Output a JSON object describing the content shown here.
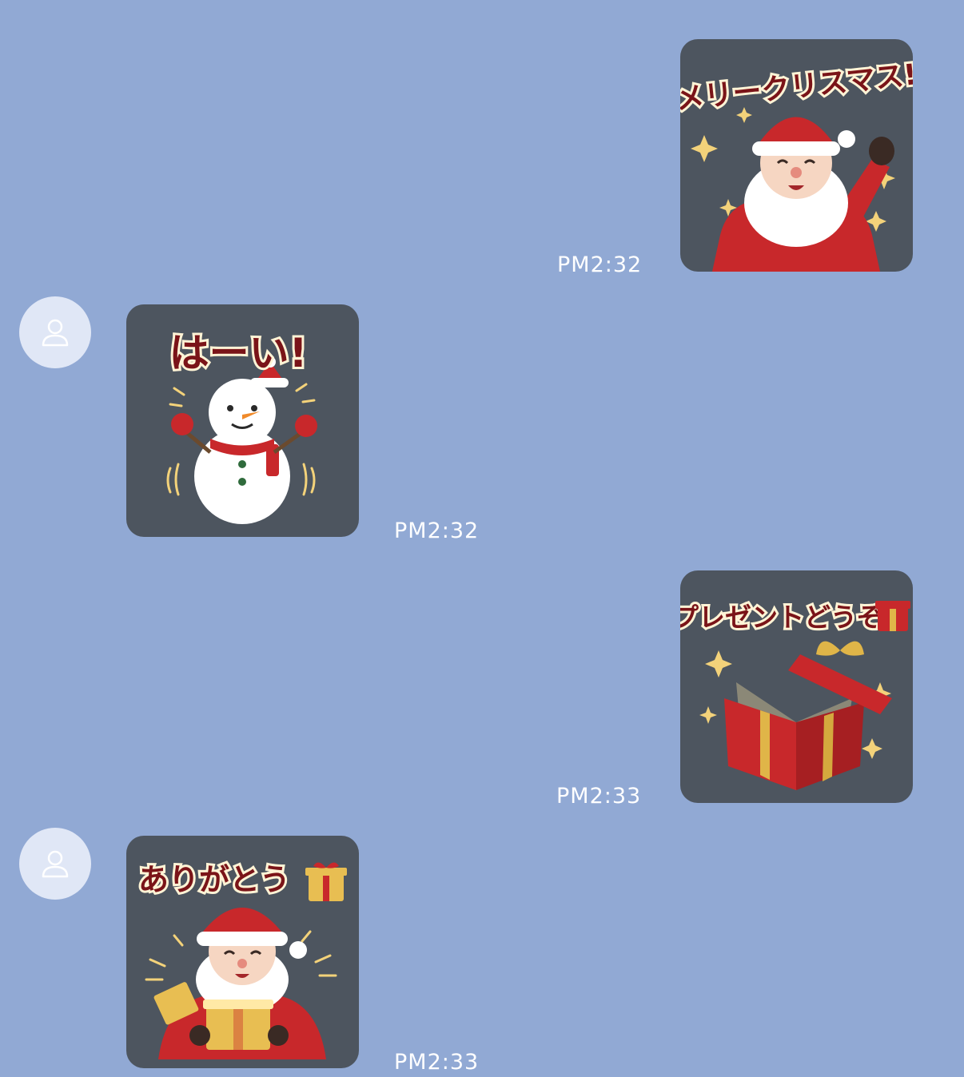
{
  "messages": [
    {
      "side": "sent",
      "sticker_text": "メリークリスマス!",
      "sticker_icon": "santa-waving-icon",
      "time": "PM2:32"
    },
    {
      "side": "received",
      "sticker_text": "はーい!",
      "sticker_icon": "snowman-icon",
      "time": "PM2:32"
    },
    {
      "side": "sent",
      "sticker_text": "プレゼントどうぞ",
      "sticker_icon": "open-gift-box-icon",
      "time": "PM2:33"
    },
    {
      "side": "received",
      "sticker_text": "ありがとう",
      "sticker_icon": "santa-with-gift-icon",
      "time": "PM2:33"
    }
  ],
  "colors": {
    "chat_background": "#91a9d4",
    "sticker_background": "#4d555f",
    "timestamp": "#ffffff",
    "avatar": "#e0e7f6",
    "sticker_lettering": "#7a1418"
  }
}
